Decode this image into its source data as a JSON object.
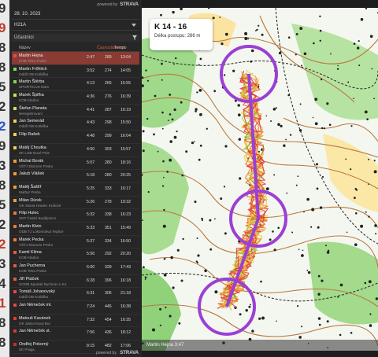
{
  "gutter_digits": [
    {
      "text": "9",
      "color": "#333"
    },
    {
      "text": "9",
      "color": "#c0392b"
    },
    {
      "text": "8",
      "color": "#333"
    },
    {
      "text": "8",
      "color": "#333"
    },
    {
      "text": "5",
      "color": "#333"
    },
    {
      "text": "2",
      "color": "#333"
    },
    {
      "text": "2",
      "color": "#2255cc"
    },
    {
      "text": "9",
      "color": "#333"
    },
    {
      "text": "3",
      "color": "#333"
    },
    {
      "text": "8",
      "color": "#333"
    },
    {
      "text": "5",
      "color": "#333"
    },
    {
      "text": "2",
      "color": "#333"
    },
    {
      "text": "2",
      "color": "#c0392b"
    },
    {
      "text": "3",
      "color": "#333"
    },
    {
      "text": "4",
      "color": "#333"
    },
    {
      "text": "1",
      "color": "#c0392b"
    },
    {
      "text": "8",
      "color": "#333"
    },
    {
      "text": "8",
      "color": "#333"
    }
  ],
  "header": {
    "date": "28. 10. 2023",
    "brand_prefix": "powered by",
    "brand": "STRAVA"
  },
  "class_select": {
    "value": "H21A",
    "icon": "chevron-down-icon"
  },
  "participants": {
    "label": "Účastníci",
    "filter_icon": "filter-icon"
  },
  "table": {
    "col_name": "Název",
    "col_time": "",
    "col_dist": "Čas/vzdálenost",
    "col_pace": "Tempo",
    "rows": [
      {
        "name": "Martin Hejna",
        "club": "KOB Tetra Praha",
        "time": "2:47",
        "dist": "289",
        "pace": "13:04",
        "color": "#e74c3c",
        "selected": true
      },
      {
        "name": "Martin Frőhlich",
        "club": "Oddíl OB Kotlářka",
        "time": "3:52",
        "dist": "274",
        "pace": "14:05",
        "color": "#7ed957",
        "selected": false
      },
      {
        "name": "Martin Štěrba",
        "club": "SPORTICUS team",
        "time": "4:13",
        "dist": "265",
        "pace": "15:55",
        "color": "#7ed957",
        "selected": false
      },
      {
        "name": "Marek Špiřka",
        "club": "KOB Kladno",
        "time": "4:36",
        "dist": "276",
        "pace": "16:39",
        "color": "#c8e35a",
        "selected": false
      },
      {
        "name": "Štefan Planeta",
        "club": "Neregistrovaní",
        "time": "4:41",
        "dist": "287",
        "pace": "16:19",
        "color": "#c8e35a",
        "selected": false
      },
      {
        "name": "Jan Semerád",
        "club": "Oddíl OB Kotlářka",
        "time": "4:43",
        "dist": "298",
        "pace": "15:50",
        "color": "#f0d24a",
        "selected": false
      },
      {
        "name": "Filip Rašek",
        "club": "",
        "time": "4:48",
        "dist": "299",
        "pace": "16:04",
        "color": "#f0d24a",
        "selected": false
      },
      {
        "name": "Matěj Choutka",
        "club": "SK LOB Nové Pole",
        "time": "4:50",
        "dist": "303",
        "pace": "15:57",
        "color": "#f0d24a",
        "selected": false
      },
      {
        "name": "Michal Borák",
        "club": "VŠTJ Ekonom Praha",
        "time": "5:07",
        "dist": "280",
        "pace": "18:16",
        "color": "#f39c3c",
        "selected": false
      },
      {
        "name": "Jakub Vlášek",
        "club": "",
        "time": "5:18",
        "dist": "280",
        "pace": "20:25",
        "color": "#f39c3c",
        "selected": false
      },
      {
        "name": "Matěj Šašlíř",
        "club": "Mathyr Praha",
        "time": "5:25",
        "dist": "333",
        "pace": "16:17",
        "color": "#f39c3c",
        "selected": false
      },
      {
        "name": "Milan Dúrek",
        "club": "OK Slavia Hradec Králové",
        "time": "5:26",
        "dist": "278",
        "pace": "19:32",
        "color": "#f39c3c",
        "selected": false
      },
      {
        "name": "Filip Hulec",
        "club": "SKP České Budějovice",
        "time": "5:32",
        "dist": "338",
        "pace": "16:23",
        "color": "#ec7a3c",
        "selected": false
      },
      {
        "name": "Martin Klein",
        "club": "ODB TJ Lokomotiva Teplice",
        "time": "5:33",
        "dist": "351",
        "pace": "15:49",
        "color": "#ec7a3c",
        "selected": false
      },
      {
        "name": "Marek Pecka",
        "club": "VŠTJ Ekonom Praha",
        "time": "5:37",
        "dist": "334",
        "pace": "16:50",
        "color": "#ec7a3c",
        "selected": false
      },
      {
        "name": "Kamil Klíma",
        "club": "KOB Kladno",
        "time": "5:56",
        "dist": "292",
        "pace": "20:20",
        "color": "#e85a3a",
        "selected": false
      },
      {
        "name": "Jan Pucherna",
        "club": "KOB Tetra Praha",
        "time": "6:00",
        "dist": "339",
        "pace": "17:43",
        "color": "#e85a3a",
        "selected": false
      },
      {
        "name": "Jiří Ptáček",
        "club": "SOOB Spartak Rychnov n.Kn.",
        "time": "6:28",
        "dist": "396",
        "pace": "16:18",
        "color": "#e85a3a",
        "selected": false
      },
      {
        "name": "Tomáš Johanovský",
        "club": "Oddíl OB Kotlářka",
        "time": "6:31",
        "dist": "306",
        "pace": "21:18",
        "color": "#e84a3a",
        "selected": false
      },
      {
        "name": "Jan Němeček ml.",
        "club": "",
        "time": "7:24",
        "dist": "445",
        "pace": "16:38",
        "color": "#e84a3a",
        "selected": false
      },
      {
        "name": "Matouš Kavánek",
        "club": "OK Jiskra Nový Bor",
        "time": "7:32",
        "dist": "454",
        "pace": "16:35",
        "color": "#e03a2a",
        "selected": false
      },
      {
        "name": "Jan Němeček st.",
        "club": "",
        "time": "7:56",
        "dist": "436",
        "pace": "18:12",
        "color": "#e03a2a",
        "selected": false
      },
      {
        "name": "Ondřej Pokorný",
        "club": "SK Praga",
        "time": "8:15",
        "dist": "482",
        "pace": "17:06",
        "color": "#d02a2a",
        "selected": false
      }
    ]
  },
  "footer": {
    "brand_prefix": "powered by",
    "brand": "STRAVA"
  },
  "map": {
    "leg_title": "K 14 - 16",
    "leg_length": "Délka postupu: 286 m",
    "status": "Martin Hejna 3:47",
    "course_color": "#9b3fd6",
    "track_color": "#e53b2a"
  }
}
